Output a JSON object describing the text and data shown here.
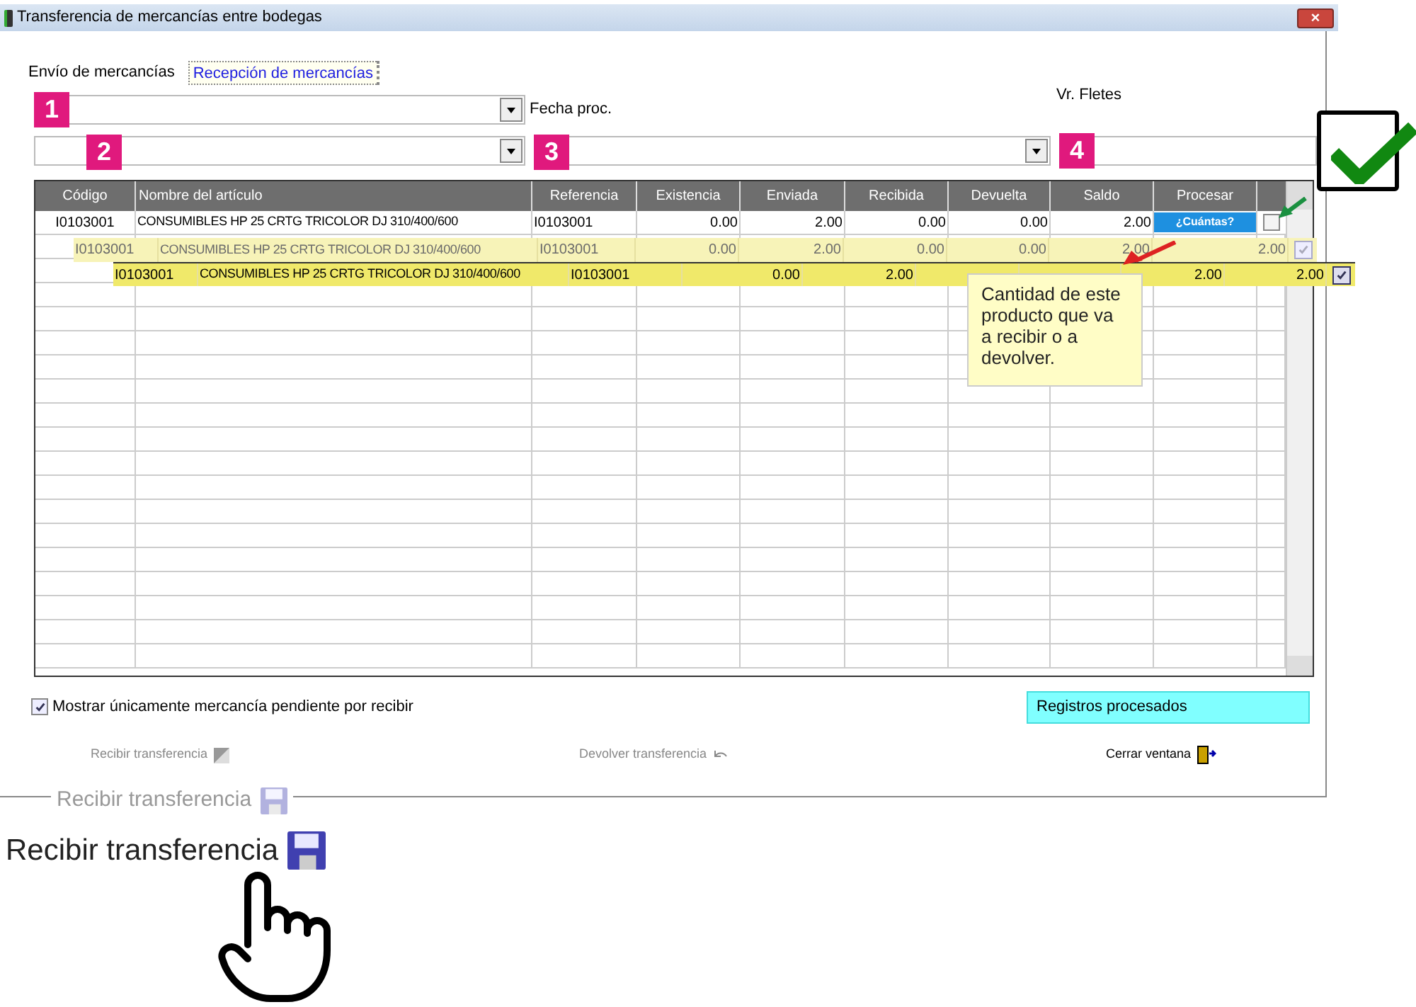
{
  "window": {
    "title": "Transferencia de mercancías entre bodegas",
    "close": "×"
  },
  "tabs": [
    {
      "label": "Envío de mercancías",
      "selected": false
    },
    {
      "label": "Recepción de mercancías",
      "selected": true
    }
  ],
  "labels": {
    "date": "Fecha proc.",
    "freight": "Vr. Fletes"
  },
  "badges": [
    "1",
    "2",
    "3",
    "4"
  ],
  "table": {
    "columns": [
      "Código",
      "Nombre del artículo",
      "Referencia",
      "Existencia",
      "Enviada",
      "Recibida",
      "Devuelta",
      "Saldo",
      "Procesar"
    ],
    "rows": [
      {
        "cells": [
          "I0103001",
          "CONSUMIBLES HP 25 CRTG TRICOLOR DJ 310/400/600",
          "I0103001",
          "0.00",
          "2.00",
          "0.00",
          "0.00",
          "2.00"
        ],
        "action": "¿Cuántas?",
        "checked": false
      }
    ]
  },
  "zoomed_rows": [
    {
      "cells": [
        "I0103001",
        "CONSUMIBLES HP 25 CRTG TRICOLOR DJ 310/400/600",
        "I0103001",
        "0.00",
        "2.00",
        "0.00",
        "0.00",
        "2.00",
        "2.00"
      ],
      "checked": true,
      "faded": true
    },
    {
      "cells": [
        "I0103001",
        "CONSUMIBLES HP 25 CRTG TRICOLOR DJ 310/400/600",
        "I0103001",
        "0.00",
        "2.00",
        "",
        "",
        "2.00",
        "2.00"
      ],
      "checked": true,
      "faded": false
    }
  ],
  "callout": "Cantidad de este producto que va a recibir o a devolver.",
  "show_pending": {
    "label": "Mostrar únicamente mercancía pendiente por recibir",
    "checked": true
  },
  "status": "Registros procesados",
  "actions": [
    {
      "label": "Recibir transferencia",
      "kind": "receive",
      "disabled": true
    },
    {
      "label": "Devolver transferencia",
      "kind": "return",
      "disabled": true
    },
    {
      "label": "Cerrar ventana",
      "kind": "close",
      "disabled": false
    }
  ],
  "zoomed_labels": [
    {
      "label": "Recibir transferencia",
      "faded": true
    },
    {
      "label": "Recibir transferencia",
      "faded": false
    }
  ]
}
